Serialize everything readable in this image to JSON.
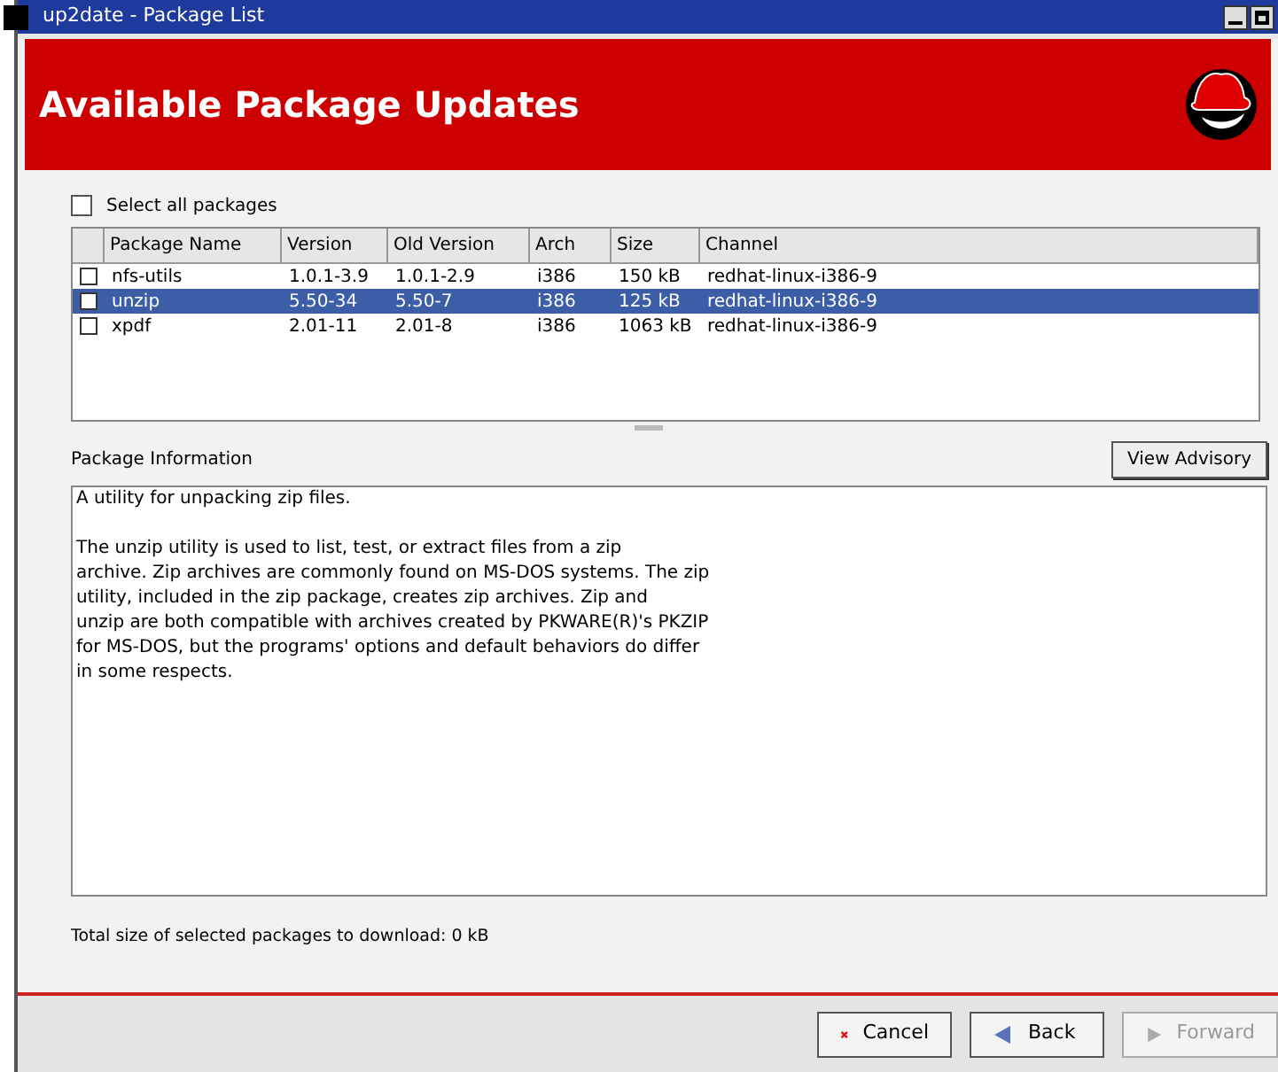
{
  "window": {
    "title": "up2date - Package List"
  },
  "header": {
    "title": "Available Package Updates"
  },
  "select_all": {
    "label": "Select all packages",
    "checked": false
  },
  "table": {
    "columns": [
      "Package Name",
      "Version",
      "Old Version",
      "Arch",
      "Size",
      "Channel"
    ],
    "rows": [
      {
        "checked": false,
        "selected": false,
        "cells": [
          "nfs-utils",
          "1.0.1-3.9",
          "1.0.1-2.9",
          "i386",
          "150 kB",
          "redhat-linux-i386-9"
        ]
      },
      {
        "checked": false,
        "selected": true,
        "cells": [
          "unzip",
          "5.50-34",
          "5.50-7",
          "i386",
          "125 kB",
          "redhat-linux-i386-9"
        ]
      },
      {
        "checked": false,
        "selected": false,
        "cells": [
          "xpdf",
          "2.01-11",
          "2.01-8",
          "i386",
          "1063 kB",
          "redhat-linux-i386-9"
        ]
      }
    ]
  },
  "info": {
    "label": "Package Information",
    "button": "View Advisory",
    "paragraphs": [
      [
        "A utility for unpacking zip files."
      ],
      [
        "The unzip utility is used to list, test, or extract files from a zip",
        "archive. Zip archives are commonly found on MS-DOS systems. The zip",
        "utility, included in the zip package, creates zip archives. Zip and",
        "unzip are both compatible with archives created by PKWARE(R)'s PKZIP",
        "for MS-DOS, but the programs' options and default behaviors do differ",
        "in some respects."
      ]
    ]
  },
  "total": "Total size of selected packages to download: 0 kB",
  "buttons": [
    {
      "kind": "cancel",
      "label": "Cancel",
      "disabled": false
    },
    {
      "kind": "back",
      "label": "Back",
      "disabled": false
    },
    {
      "kind": "forward",
      "label": "Forward",
      "disabled": true
    }
  ]
}
